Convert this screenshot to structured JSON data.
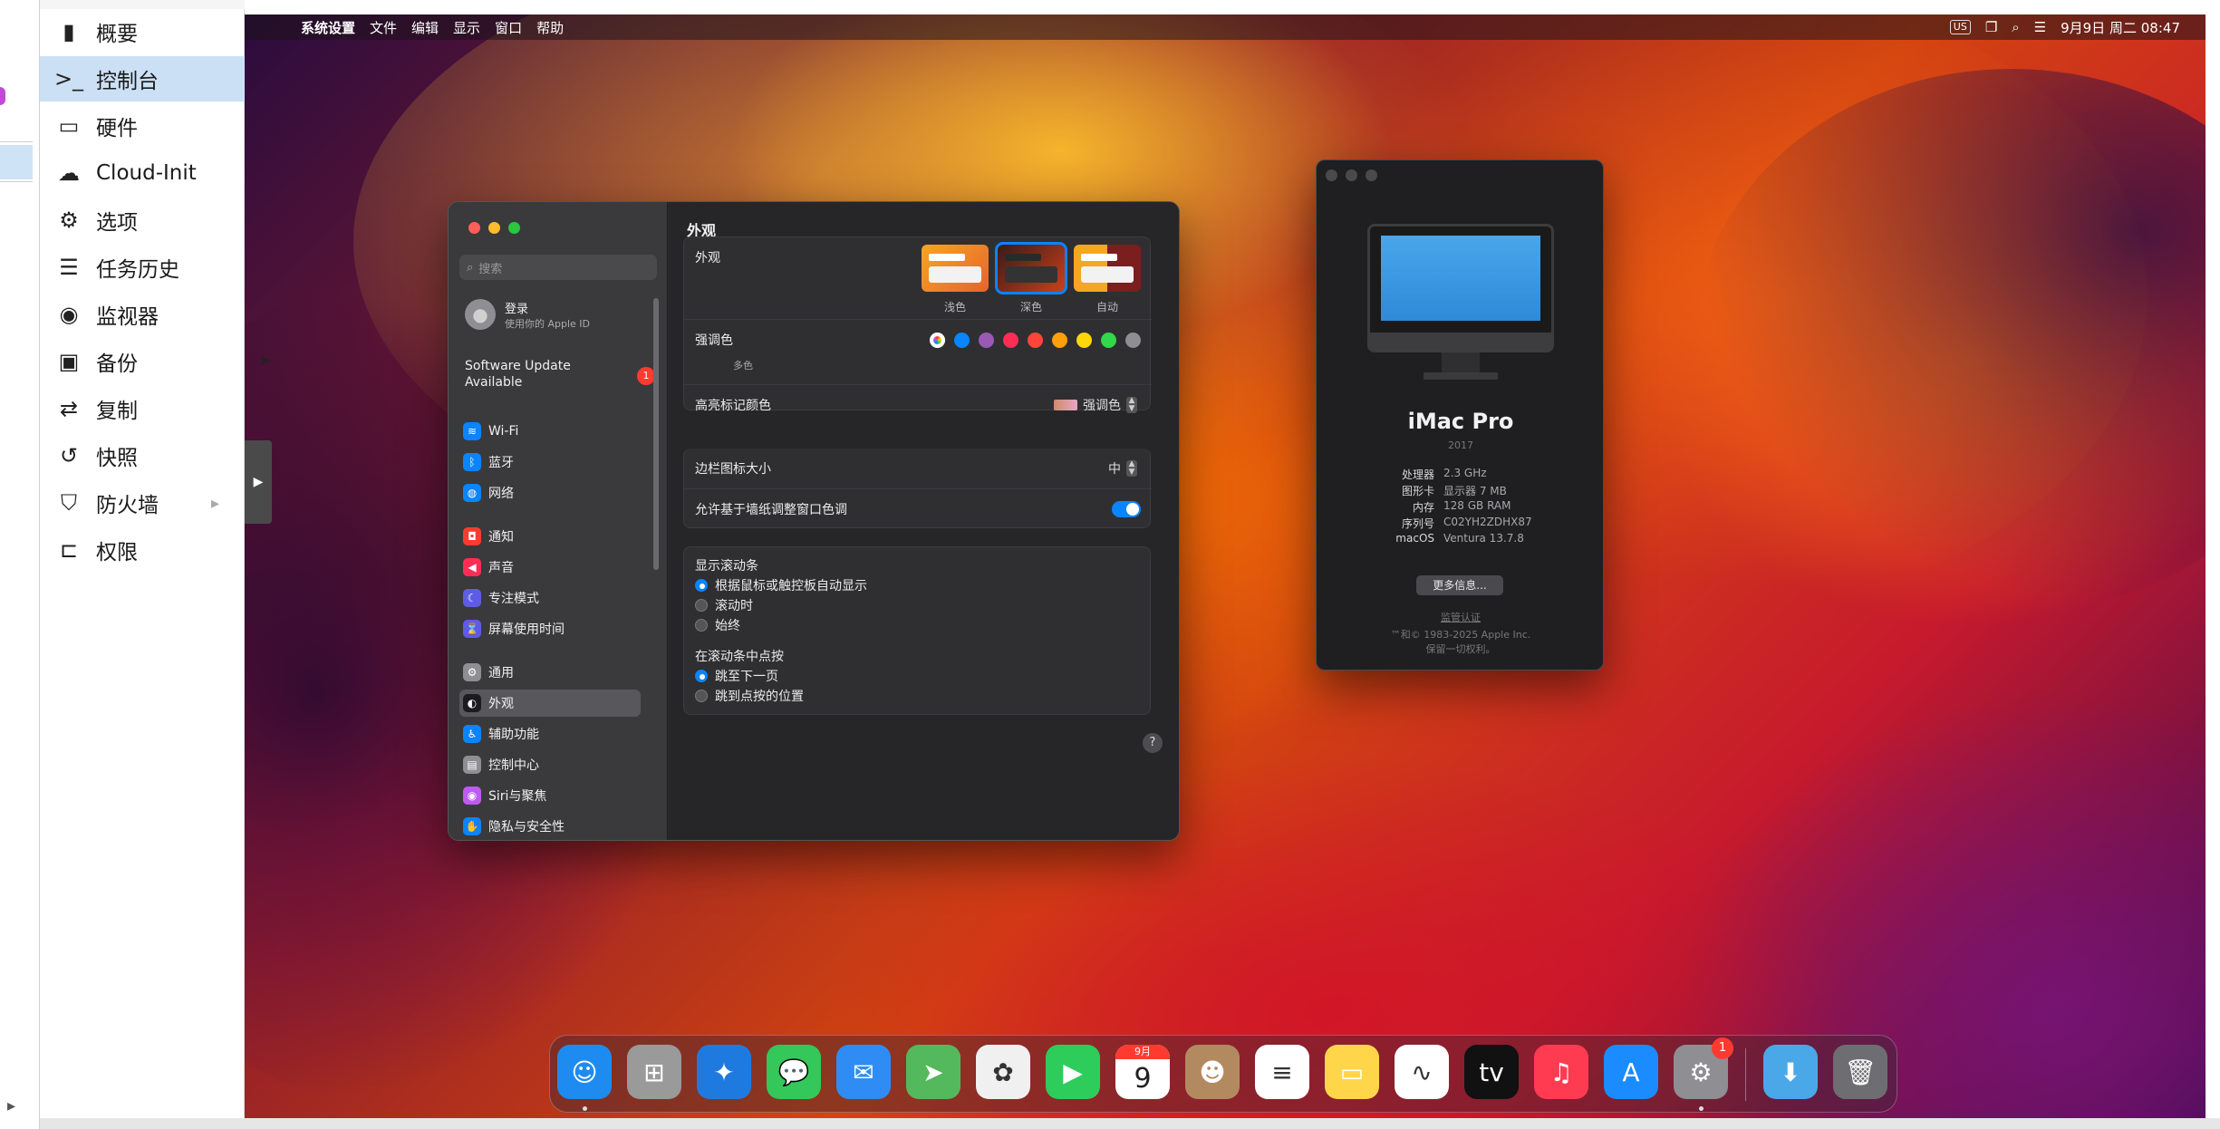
{
  "proxmox_menu": {
    "items": [
      {
        "label": "概要",
        "icon": "book-icon"
      },
      {
        "label": "控制台",
        "icon": "terminal-icon"
      },
      {
        "label": "硬件",
        "icon": "monitor-icon"
      },
      {
        "label": "Cloud-Init",
        "icon": "cloud-icon"
      },
      {
        "label": "选项",
        "icon": "gear-icon"
      },
      {
        "label": "任务历史",
        "icon": "list-icon"
      },
      {
        "label": "监视器",
        "icon": "eye-icon"
      },
      {
        "label": "备份",
        "icon": "floppy-icon"
      },
      {
        "label": "复制",
        "icon": "retweet-icon"
      },
      {
        "label": "快照",
        "icon": "history-icon"
      },
      {
        "label": "防火墙",
        "icon": "shield-icon"
      },
      {
        "label": "权限",
        "icon": "unlock-icon"
      }
    ],
    "active_index": 1
  },
  "menubar": {
    "app": "系统设置",
    "items": [
      "文件",
      "编辑",
      "显示",
      "窗口",
      "帮助"
    ],
    "input": "US",
    "datetime": "9月9日 周二  08:47"
  },
  "settings": {
    "search_placeholder": "搜索",
    "login_title": "登录",
    "login_sub": "使用你的 Apple ID",
    "update_text": "Software Update Available",
    "update_badge": "1",
    "sidebar": [
      {
        "label": "Wi-Fi",
        "color": "#0a84ff",
        "glyph": "≋"
      },
      {
        "label": "蓝牙",
        "color": "#0a84ff",
        "glyph": "ᛒ"
      },
      {
        "label": "网络",
        "color": "#0a84ff",
        "glyph": "◍"
      },
      {
        "label": "通知",
        "color": "#ff3b30",
        "glyph": "◘"
      },
      {
        "label": "声音",
        "color": "#ff2d55",
        "glyph": "◀"
      },
      {
        "label": "专注模式",
        "color": "#5e5ce6",
        "glyph": "☾"
      },
      {
        "label": "屏幕使用时间",
        "color": "#5e5ce6",
        "glyph": "⌛"
      },
      {
        "label": "通用",
        "color": "#8e8e93",
        "glyph": "⚙"
      },
      {
        "label": "外观",
        "color": "#1c1c1e",
        "glyph": "◐"
      },
      {
        "label": "辅助功能",
        "color": "#0a84ff",
        "glyph": "♿"
      },
      {
        "label": "控制中心",
        "color": "#8e8e93",
        "glyph": "▤"
      },
      {
        "label": "Siri与聚焦",
        "color": "#bf5af2",
        "glyph": "◉"
      },
      {
        "label": "隐私与安全性",
        "color": "#0a84ff",
        "glyph": "✋"
      }
    ],
    "active_sidebar": 8,
    "title": "外观",
    "appearance_label": "外观",
    "appearance_options": [
      "浅色",
      "深色",
      "自动"
    ],
    "appearance_selected": 1,
    "accent_label": "强调色",
    "accent_colors": [
      "#bf5af2",
      "#0a84ff",
      "#9b59b6",
      "#ff2d55",
      "#ff453a",
      "#ff9f0a",
      "#ffd60a",
      "#32d74b",
      "#8e8e93"
    ],
    "accent_multi_label": "多色",
    "highlight_label": "高亮标记颜色",
    "highlight_value": "强调色",
    "sidebar_icon_label": "边栏图标大小",
    "sidebar_icon_value": "中",
    "wallpaper_tint_label": "允许基于墙纸调整窗口色调",
    "wallpaper_tint_on": true,
    "scrollbar_heading": "显示滚动条",
    "scrollbar_options": [
      "根据鼠标或触控板自动显示",
      "滚动时",
      "始终"
    ],
    "scrollbar_selected": 0,
    "click_heading": "在滚动条中点按",
    "click_options": [
      "跳至下一页",
      "跳到点按的位置"
    ],
    "click_selected": 0,
    "help": "?"
  },
  "about": {
    "name": "iMac Pro",
    "year": "2017",
    "specs": [
      {
        "k": "处理器",
        "v": "2.3 GHz"
      },
      {
        "k": "图形卡",
        "v": "显示器 7 MB"
      },
      {
        "k": "内存",
        "v": "128 GB RAM"
      },
      {
        "k": "序列号",
        "v": "C02YH2ZDHX87"
      },
      {
        "k": "macOS",
        "v": "Ventura 13.7.8"
      }
    ],
    "more_button": "更多信息...",
    "regulatory": "监管认证",
    "copyright_line1": "™和© 1983-2025 Apple Inc.",
    "copyright_line2": "保留一切权利。"
  },
  "dock": {
    "apps": [
      {
        "name": "finder-icon",
        "color": "#1e8bf0",
        "glyph": "☺"
      },
      {
        "name": "launchpad-icon",
        "color": "#9a9a9a",
        "glyph": "⊞"
      },
      {
        "name": "safari-icon",
        "color": "#1f7ae0",
        "glyph": "✦"
      },
      {
        "name": "messages-icon",
        "color": "#34c759",
        "glyph": "💬"
      },
      {
        "name": "mail-icon",
        "color": "#2f8cf5",
        "glyph": "✉"
      },
      {
        "name": "maps-icon",
        "color": "#54b95d",
        "glyph": "➤"
      },
      {
        "name": "photos-icon",
        "color": "#f0f0f0",
        "glyph": "✿"
      },
      {
        "name": "facetime-icon",
        "color": "#2ecc5a",
        "glyph": "▶"
      },
      {
        "name": "calendar-icon",
        "color": "#ffffff",
        "glyph": "9"
      },
      {
        "name": "contacts-icon",
        "color": "#b38a60",
        "glyph": "☻"
      },
      {
        "name": "reminders-icon",
        "color": "#ffffff",
        "glyph": "≡"
      },
      {
        "name": "notes-icon",
        "color": "#ffd54a",
        "glyph": "▭"
      },
      {
        "name": "freeform-icon",
        "color": "#ffffff",
        "glyph": "∿"
      },
      {
        "name": "tv-icon",
        "color": "#111111",
        "glyph": "tv"
      },
      {
        "name": "music-icon",
        "color": "#ff3b52",
        "glyph": "♫"
      },
      {
        "name": "appstore-icon",
        "color": "#1a8cff",
        "glyph": "A"
      },
      {
        "name": "system-settings-icon",
        "color": "#8e8e93",
        "glyph": "⚙"
      }
    ],
    "calendar_month": "9月",
    "settings_badge": "1",
    "downloads": {
      "name": "downloads-folder-icon",
      "color": "#4aa8e8",
      "glyph": "⬇"
    },
    "trash": {
      "name": "trash-icon",
      "color": "#6e6e72",
      "glyph": "🗑"
    }
  }
}
